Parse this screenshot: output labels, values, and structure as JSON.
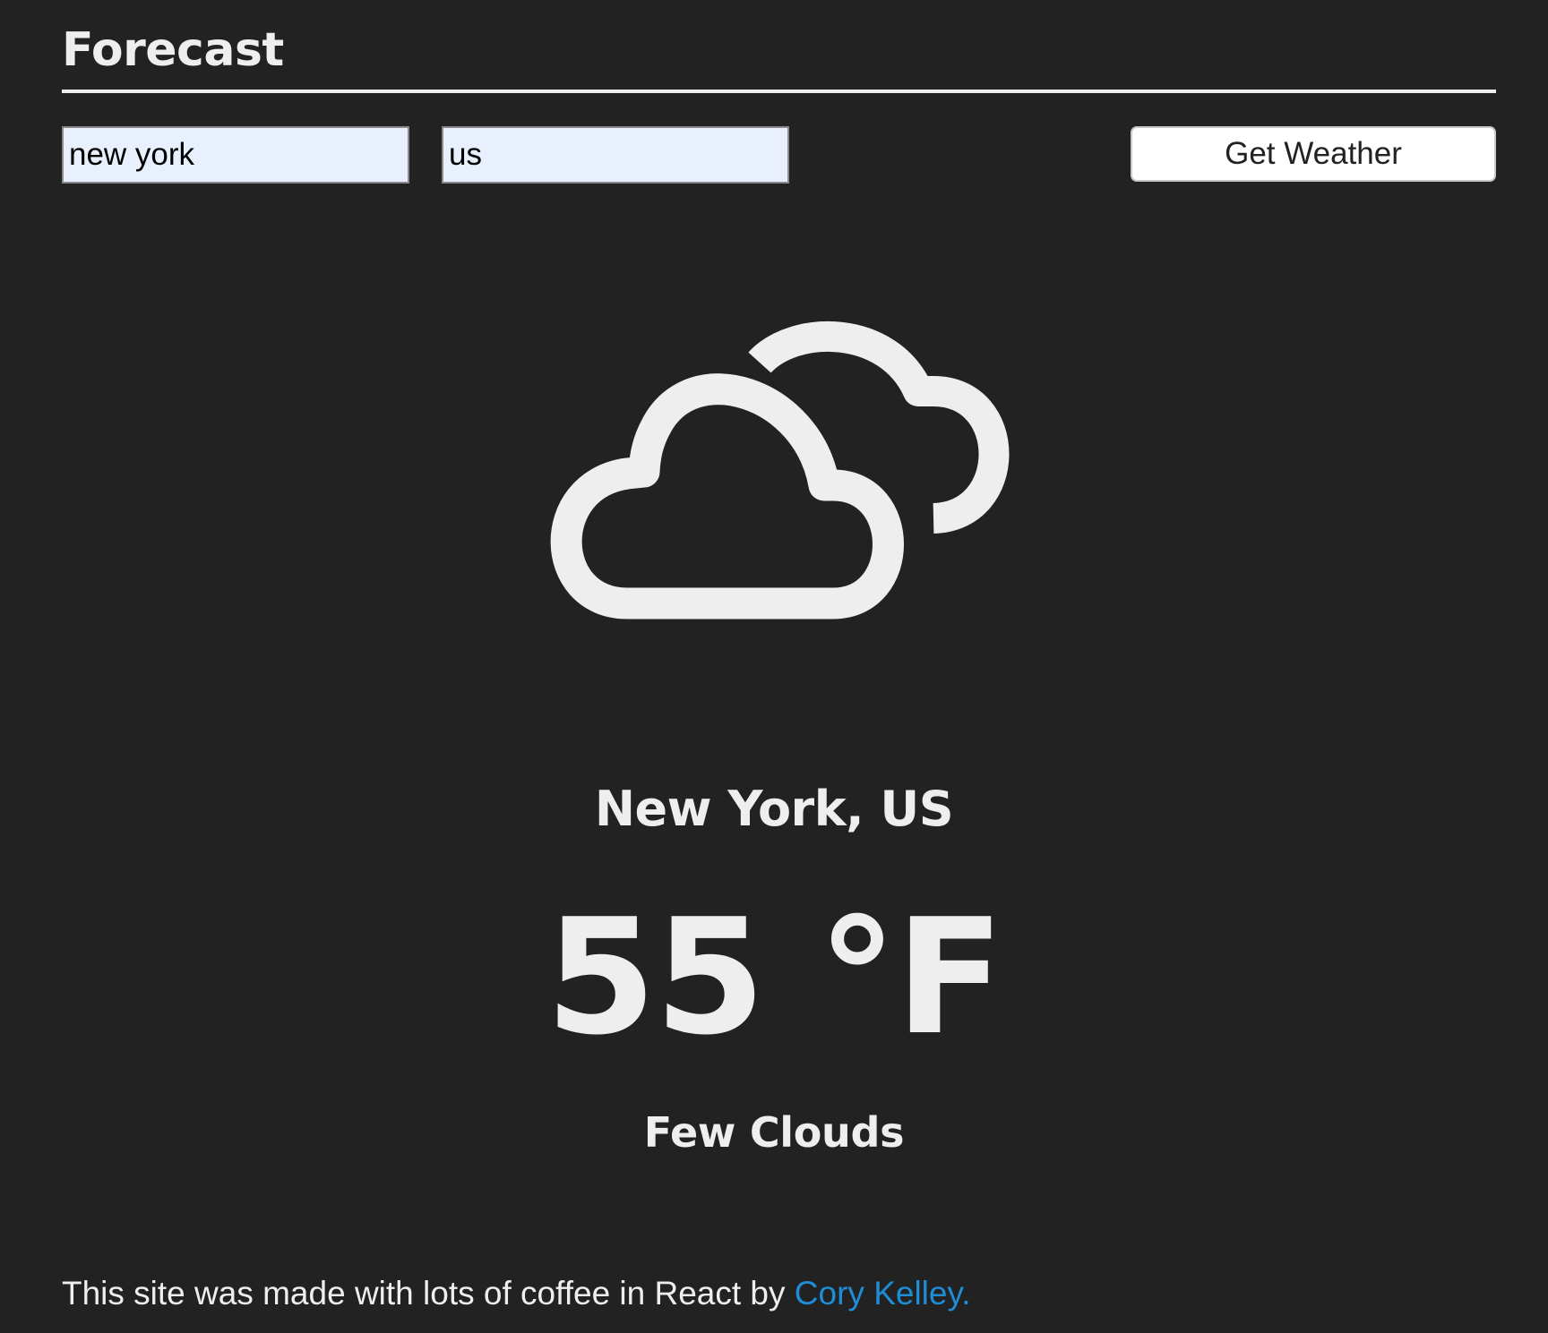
{
  "header": {
    "title": "Forecast"
  },
  "search": {
    "city_value": "new york",
    "country_value": "us",
    "button_label": "Get Weather"
  },
  "weather": {
    "icon": "few-clouds-icon",
    "location": "New York, US",
    "temperature": "55 °F",
    "condition": "Few Clouds"
  },
  "footer": {
    "text": "This site was made with lots of coffee in React by ",
    "link_label": "Cory Kelley."
  },
  "colors": {
    "background": "#222222",
    "foreground": "#eeeeee",
    "input_background": "#e8f0fe",
    "link": "#1f8dd6"
  }
}
